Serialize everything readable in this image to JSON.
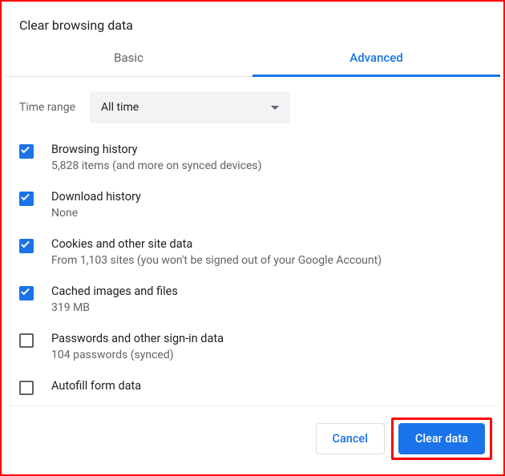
{
  "dialog": {
    "title": "Clear browsing data",
    "tabs": {
      "basic": "Basic",
      "advanced": "Advanced"
    },
    "timeRange": {
      "label": "Time range",
      "value": "All time"
    },
    "items": [
      {
        "title": "Browsing history",
        "sub": "5,828 items (and more on synced devices)",
        "checked": true
      },
      {
        "title": "Download history",
        "sub": "None",
        "checked": true
      },
      {
        "title": "Cookies and other site data",
        "sub": "From 1,103 sites (you won't be signed out of your Google Account)",
        "checked": true
      },
      {
        "title": "Cached images and files",
        "sub": "319 MB",
        "checked": true
      },
      {
        "title": "Passwords and other sign-in data",
        "sub": "104 passwords (synced)",
        "checked": false
      },
      {
        "title": "Autofill form data",
        "sub": "",
        "checked": false
      }
    ],
    "buttons": {
      "cancel": "Cancel",
      "clear": "Clear data"
    }
  }
}
